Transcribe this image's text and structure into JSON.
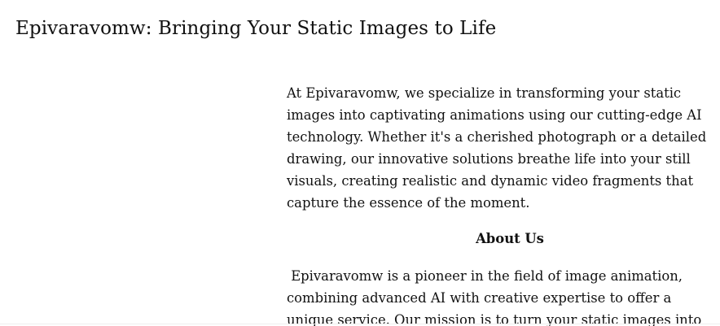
{
  "header": {
    "title": "Epivaravomw: Bringing Your Static Images to Life"
  },
  "intro": {
    "lines": [
      "At Epivaravomw, we specialize in transforming your static",
      "images into captivating animations using our cutting-edge AI",
      "technology. Whether it's a cherished photograph or a detailed",
      "drawing, our innovative solutions breathe life into your still",
      "visuals, creating realistic and dynamic video fragments that",
      "capture the essence of the moment."
    ]
  },
  "about": {
    "heading": "About Us",
    "lines": [
      " Epivaravomw is a pioneer in the field of image animation,",
      "combining advanced AI with creative expertise to offer a",
      "unique service. Our mission is to turn your static images into"
    ]
  }
}
